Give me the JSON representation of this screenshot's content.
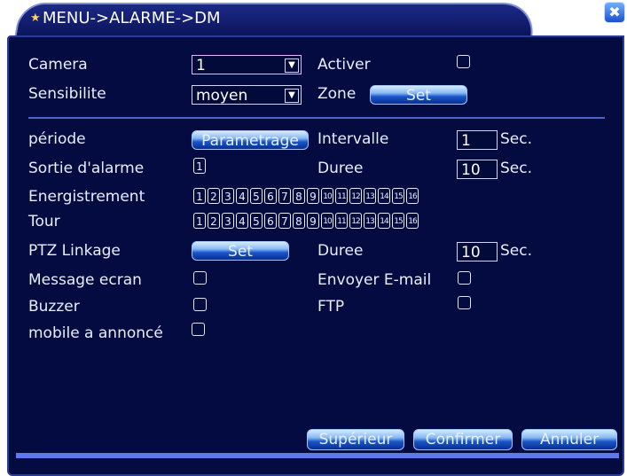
{
  "title": "MENU->ALARME->DM",
  "close_symbol": "✖",
  "row1": {
    "camera_label": "Camera",
    "camera_value": "1",
    "activer_label": "Activer"
  },
  "row2": {
    "sensibilite_label": "Sensibilite",
    "sensibilite_value": "moyen",
    "zone_label": "Zone",
    "zone_button": "Set"
  },
  "periode": {
    "label": "période",
    "button": "Parametrage",
    "intervalle_label": "Intervalle",
    "intervalle_value": "1",
    "unit": "Sec."
  },
  "sortie": {
    "label": "Sortie d'alarme",
    "value": "1",
    "duree_label": "Duree",
    "duree_value": "10",
    "unit": "Sec."
  },
  "enregistrement": {
    "label": "Energistrement",
    "channels": [
      "1",
      "2",
      "3",
      "4",
      "5",
      "6",
      "7",
      "8",
      "9",
      "10",
      "11",
      "12",
      "13",
      "14",
      "15",
      "16"
    ]
  },
  "tour": {
    "label": "Tour",
    "channels": [
      "1",
      "2",
      "3",
      "4",
      "5",
      "6",
      "7",
      "8",
      "9",
      "10",
      "11",
      "12",
      "13",
      "14",
      "15",
      "16"
    ]
  },
  "ptz": {
    "label": "PTZ Linkage",
    "button": "Set",
    "duree_label": "Duree",
    "duree_value": "10",
    "unit": "Sec."
  },
  "message": {
    "label": "Message ecran",
    "email_label": "Envoyer E-mail"
  },
  "buzzer": {
    "label": "Buzzer",
    "ftp_label": "FTP"
  },
  "mobile": {
    "label": "mobile a annoncé"
  },
  "footer": {
    "superieur": "Supérieur",
    "confirmer": "Confirmer",
    "annuler": "Annuler"
  },
  "colors": {
    "background": "#030b40",
    "accent": "#1a55c9",
    "text": "#e8eeff"
  }
}
